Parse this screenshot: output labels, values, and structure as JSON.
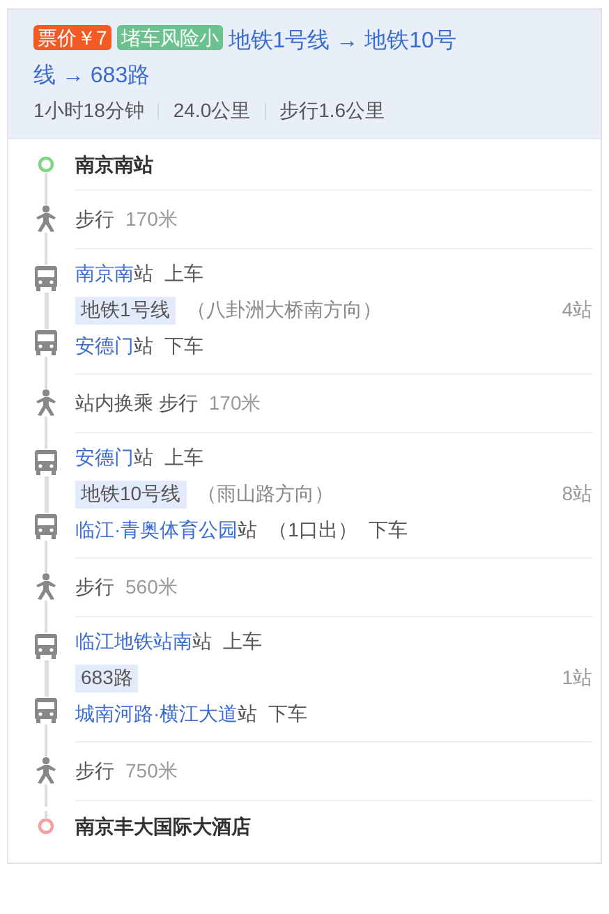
{
  "summary": {
    "tags": [
      {
        "text": "票价￥7",
        "color": "#f35b25"
      },
      {
        "text": "堵车风险小",
        "color": "#6bc28f"
      }
    ],
    "route_lines": [
      "地铁1号线 → 地铁10号",
      "线 → 683路"
    ],
    "stats": [
      "1小时18分钟",
      "24.0公里",
      "步行1.6公里"
    ]
  },
  "steps": [
    {
      "kind": "start",
      "name": "南京南站"
    },
    {
      "kind": "walk",
      "label": "步行",
      "distance": "170米"
    },
    {
      "kind": "transit",
      "board": {
        "station": "南京南",
        "suffix": "站",
        "action": "上车"
      },
      "line": {
        "name": "地铁1号线",
        "direction": "（八卦洲大桥南方向）",
        "stops": "4站"
      },
      "alight": {
        "station": "安德门",
        "suffix": "站",
        "action": "下车"
      }
    },
    {
      "kind": "walk",
      "label": "站内换乘 步行",
      "distance": "170米"
    },
    {
      "kind": "transit",
      "board": {
        "station": "安德门",
        "suffix": "站",
        "action": "上车"
      },
      "line": {
        "name": "地铁10号线",
        "direction": "（雨山路方向）",
        "stops": "8站"
      },
      "alight": {
        "station": "临江·青奥体育公园",
        "suffix": "站",
        "exit": "（1口出）",
        "action": "下车"
      }
    },
    {
      "kind": "walk",
      "label": "步行",
      "distance": "560米"
    },
    {
      "kind": "transit",
      "board": {
        "station": "临江地铁站南",
        "suffix": "站",
        "action": "上车"
      },
      "line": {
        "name": "683路",
        "stops": "1站"
      },
      "alight": {
        "station": "城南河路·横江大道",
        "suffix": "站",
        "action": "下车"
      }
    },
    {
      "kind": "walk",
      "label": "步行",
      "distance": "750米"
    },
    {
      "kind": "end",
      "name": "南京丰大国际大酒店"
    }
  ]
}
